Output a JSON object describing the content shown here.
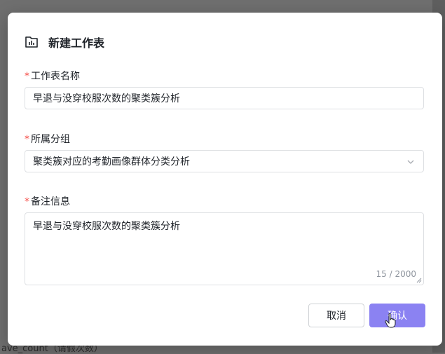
{
  "background": {
    "fragments": [
      {
        "text": "ave_count（请假次数）"
      }
    ]
  },
  "dialog": {
    "title": "新建工作表",
    "title_icon": "chart-sheet-icon",
    "fields": {
      "name": {
        "required_mark": "*",
        "label": "工作表名称",
        "value": "早退与没穿校服次数的聚类簇分析"
      },
      "group": {
        "required_mark": "*",
        "label": "所属分组",
        "value": "聚类簇对应的考勤画像群体分类分析",
        "icon": "chevron-down-icon"
      },
      "remark": {
        "required_mark": "*",
        "label": "备注信息",
        "value": "早退与没穿校服次数的聚类簇分析",
        "counter": "15 / 2000"
      }
    },
    "buttons": {
      "cancel": "取消",
      "confirm": "确认"
    }
  },
  "colors": {
    "primary": "#8b82f2",
    "required": "#f54a45",
    "border": "#dee0e3"
  }
}
